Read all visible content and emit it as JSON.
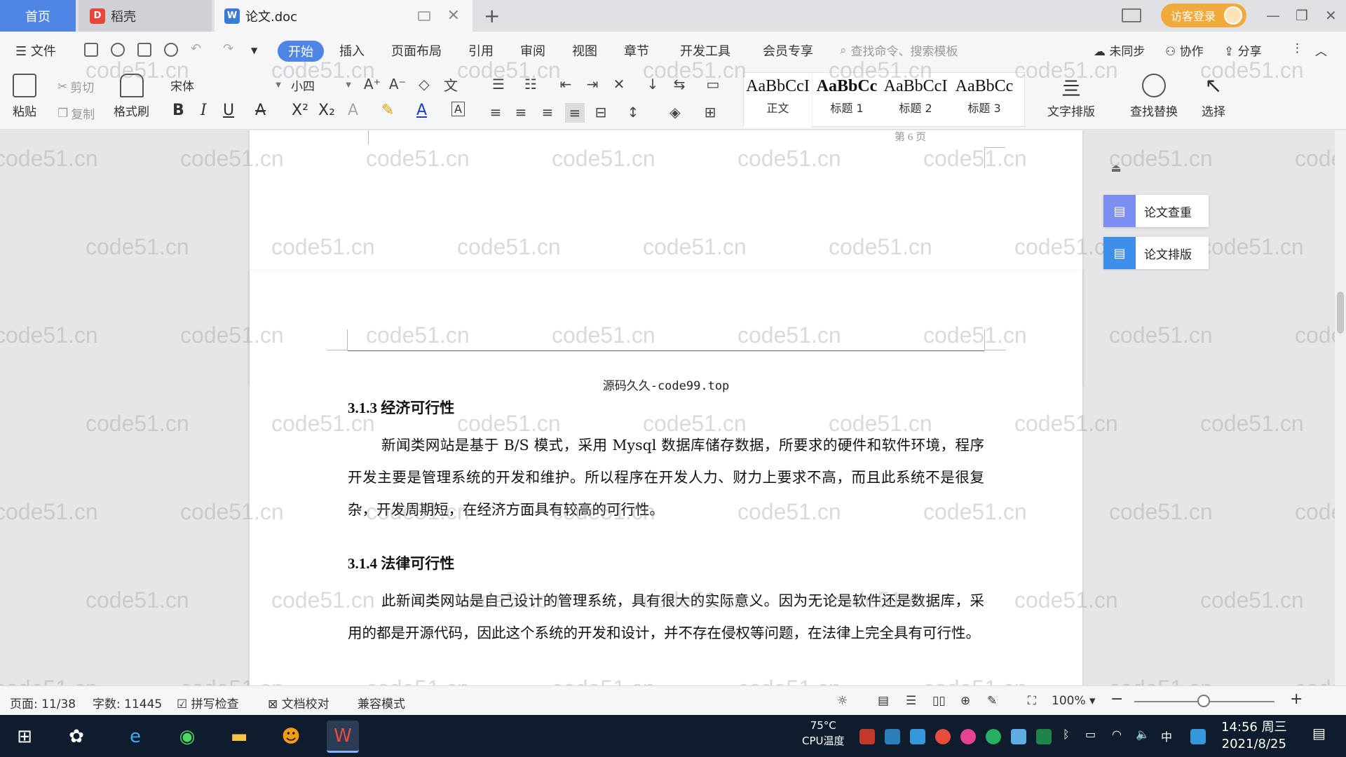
{
  "tabs": {
    "home": "首页",
    "daoke": "稻壳",
    "doc": "论文.doc"
  },
  "titlebar": {
    "login": "访客登录"
  },
  "menu": {
    "file": "文件",
    "items": [
      "开始",
      "插入",
      "页面布局",
      "引用",
      "审阅",
      "视图",
      "章节",
      "开发工具",
      "会员专享"
    ],
    "search_placeholder": "查找命令、搜索模板",
    "sync": "未同步",
    "collab": "协作",
    "share": "分享"
  },
  "ribbon": {
    "paste": "粘贴",
    "cut": "剪切",
    "copy": "复制",
    "format_painter": "格式刷",
    "font_name": "宋体",
    "font_size": "小四",
    "styles": [
      {
        "preview": "AaBbCcI",
        "name": "正文"
      },
      {
        "preview": "AaBbCc",
        "name": "标题 1"
      },
      {
        "preview": "AaBbCcI",
        "name": "标题 2"
      },
      {
        "preview": "AaBbCc",
        "name": "标题 3"
      }
    ],
    "text_layout": "文字排版",
    "find_replace": "查找替换",
    "select": "选择"
  },
  "document": {
    "page_number": "第 6 页",
    "header_text": "源码久久-code99.top",
    "section1_title": "3.1.3  经济可行性",
    "section1_body": "新闻类网站是基于 B/S 模式，采用 Mysql 数据库储存数据，所要求的硬件和软件环境，程序开发主要是管理系统的开发和维护。所以程序在开发人力、财力上要求不高，而且此系统不是很复杂，开发周期短，在经济方面具有较高的可行性。",
    "section2_title": "3.1.4  法律可行性",
    "section2_body": "此新闻类网站是自己设计的管理系统，具有很大的实际意义。因为无论是软件还是数据库，采用的都是开源代码，因此这个系统的开发和设计，并不存在侵权等问题，在法律上完全具有可行性。",
    "watermark": "code51.cn"
  },
  "side_panel": {
    "plagiarism_check": "论文查重",
    "paper_layout": "论文排版"
  },
  "statusbar": {
    "page": "页面: 11/38",
    "words": "字数: 11445",
    "spell_check": "拼写检查",
    "doc_proof": "文档校对",
    "compat_mode": "兼容模式",
    "zoom": "100%"
  },
  "taskbar": {
    "cpu_temp": "75°C",
    "cpu_label": "CPU温度",
    "ime": "中",
    "time": "14:56 周三",
    "date": "2021/8/25"
  },
  "colors": {
    "accent": "#4f86e6",
    "login": "#f2a93b",
    "taskbar": "#0f1c2e"
  }
}
